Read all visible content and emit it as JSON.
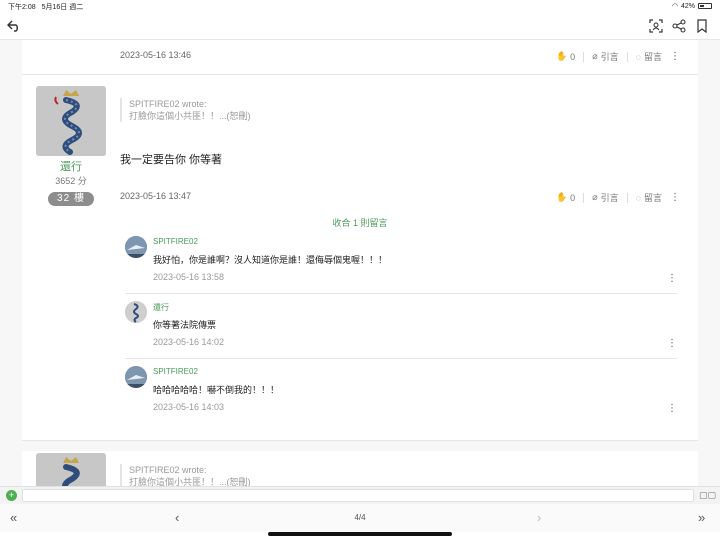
{
  "status_bar": {
    "time": "下午2:08",
    "date": "5月16日 週二",
    "battery": "42%"
  },
  "toolbar": {
    "back_icon": "reply-back-icon",
    "scan_icon": "scan-icon",
    "share_icon": "share-icon",
    "bookmark_icon": "bookmark-icon"
  },
  "post_prev": {
    "time": "2023-05-16 13:46",
    "like_count": "0",
    "quote_label": "引言",
    "comment_label": "留言"
  },
  "post": {
    "username": "還行",
    "score": "3652 分",
    "floor": "32 樓",
    "quote_author": "SPITFIRE02 wrote:",
    "quote_text": "打臉你這個小共匪！！...(恕刪)",
    "body": "我一定要告你 你等著",
    "time": "2023-05-16 13:47",
    "like_count": "0",
    "quote_label": "引言",
    "comment_label": "留言",
    "collapse_label": "收合 1 則留言"
  },
  "comments": [
    {
      "name": "SPITFIRE02",
      "text": "我好怕，你是誰啊？沒人知道你是誰！還侮辱個鬼喔！！！",
      "time": "2023-05-16 13:58"
    },
    {
      "name": "還行",
      "text": "你等著法院傳票",
      "time": "2023-05-16 14:02"
    },
    {
      "name": "SPITFIRE02",
      "text": "哈哈哈哈哈！嚇不倒我的！！！",
      "time": "2023-05-16 14:03"
    }
  ],
  "post_next": {
    "quote_author": "SPITFIRE02 wrote:",
    "quote_text": "打臉你這個小共匪！！...(恕刪)"
  },
  "reply_bar": {
    "placeholder": ""
  },
  "pager": {
    "page": "4/4"
  },
  "colors": {
    "accent_green": "#4a9a58",
    "background": "#f7f7f7"
  }
}
